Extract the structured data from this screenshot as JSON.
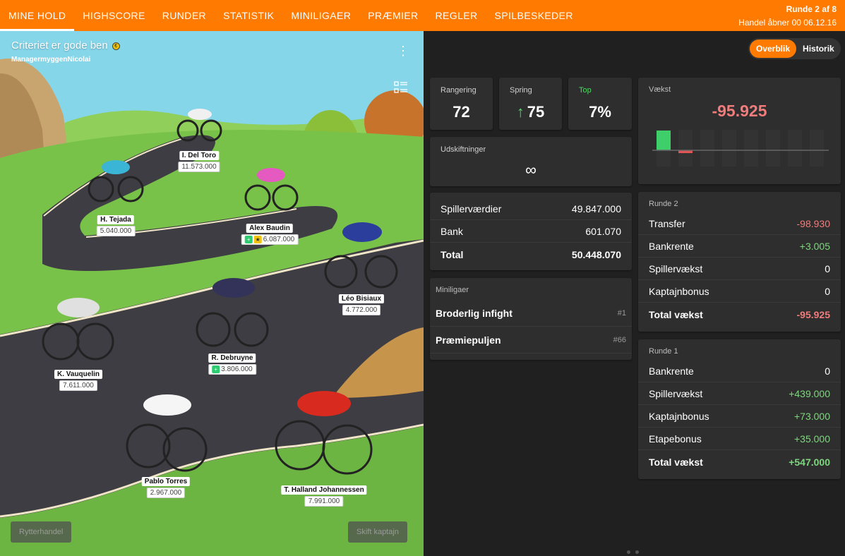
{
  "nav": {
    "items": [
      "MINE HOLD",
      "HIGHSCORE",
      "RUNDER",
      "STATISTIK",
      "MINILIGAER",
      "PRÆMIER",
      "REGLER",
      "SPILBESKEDER"
    ],
    "active_index": 0,
    "round": "Runde 2 af 8",
    "trade_open": "Handel åbner 00 06.12.16"
  },
  "team": {
    "title": "Criteriet er gode ben",
    "manager": "ManagermyggenNicolai"
  },
  "riders": [
    {
      "name": "I. Del Toro",
      "value": "11.573.000",
      "badges": []
    },
    {
      "name": "H. Tejada",
      "value": "5.040.000",
      "badges": []
    },
    {
      "name": "Alex Baudin",
      "value": "6.087.000",
      "badges": [
        "+",
        "★"
      ]
    },
    {
      "name": "Léo Bisiaux",
      "value": "4.772.000",
      "badges": []
    },
    {
      "name": "R. Debruyne",
      "value": "3.806.000",
      "badges": [
        "+"
      ]
    },
    {
      "name": "K. Vauquelin",
      "value": "7.611.000",
      "badges": []
    },
    {
      "name": "Pablo Torres",
      "value": "2.967.000",
      "badges": []
    },
    {
      "name": "T. Halland Johannessen",
      "value": "7.991.000",
      "badges": []
    }
  ],
  "buttons": {
    "rider_trade": "Rytterhandel",
    "change_captain": "Skift kaptajn"
  },
  "view_toggle": {
    "overview": "Overblik",
    "history": "Historik",
    "active": "overview"
  },
  "stats": {
    "ranking": {
      "label": "Rangering",
      "value": "72"
    },
    "jump": {
      "label": "Spring",
      "value": "75"
    },
    "top": {
      "label": "Top",
      "value": "7%"
    },
    "substitutions": {
      "label": "Udskiftninger",
      "value": "∞"
    }
  },
  "growth": {
    "label": "Vækst",
    "value": "-95.925",
    "bars": [
      439,
      -95.925,
      0,
      0,
      0,
      0,
      0,
      0
    ],
    "colors": {
      "positive": "#3ecf6a",
      "negative": "#e05555"
    }
  },
  "values": {
    "rows": [
      {
        "label": "Spillerværdier",
        "value": "49.847.000"
      },
      {
        "label": "Bank",
        "value": "601.070"
      },
      {
        "label": "Total",
        "value": "50.448.070"
      }
    ]
  },
  "minileagues": {
    "label": "Miniligaer",
    "rows": [
      {
        "name": "Broderlig infight",
        "rank": "#1"
      },
      {
        "name": "Præmiepuljen",
        "rank": "#66"
      }
    ]
  },
  "round2": {
    "label": "Runde 2",
    "rows": [
      {
        "label": "Transfer",
        "value": "-98.930"
      },
      {
        "label": "Bankrente",
        "value": "+3.005"
      },
      {
        "label": "Spillervækst",
        "value": "0"
      },
      {
        "label": "Kaptajnbonus",
        "value": "0"
      },
      {
        "label": "Total vækst",
        "value": "-95.925"
      }
    ]
  },
  "round1": {
    "label": "Runde 1",
    "rows": [
      {
        "label": "Bankrente",
        "value": "0"
      },
      {
        "label": "Spillervækst",
        "value": "+439.000"
      },
      {
        "label": "Kaptajnbonus",
        "value": "+73.000"
      },
      {
        "label": "Etapebonus",
        "value": "+35.000"
      },
      {
        "label": "Total vækst",
        "value": "+547.000"
      }
    ]
  },
  "colors": {
    "accent": "#ff7a00",
    "panel": "#2e2e2e",
    "background": "#202020"
  }
}
